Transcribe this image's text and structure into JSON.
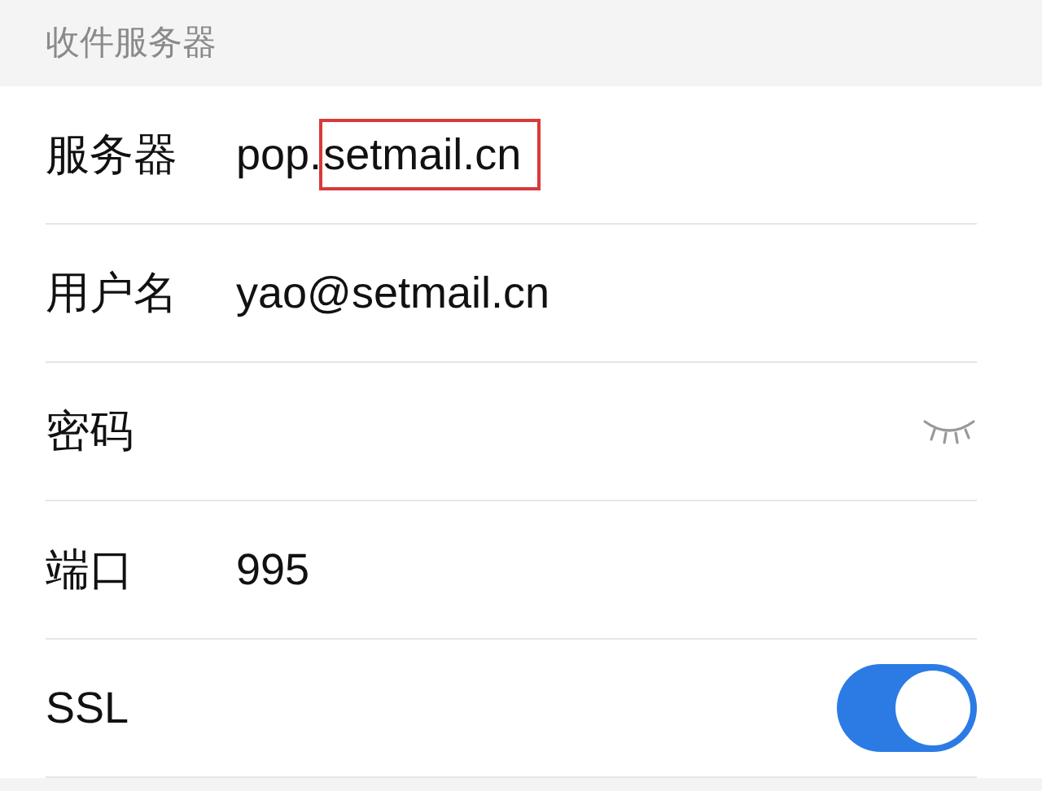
{
  "section_header": "收件服务器",
  "rows": [
    {
      "kind": "text",
      "label": "服务器",
      "value_parts": [
        {
          "text": "pop.",
          "highlighted": false
        },
        {
          "text": "setmail.cn",
          "highlighted": true
        }
      ]
    },
    {
      "kind": "text",
      "label": "用户名",
      "value_parts": [
        {
          "text": "yao@setmail.cn",
          "highlighted": false
        }
      ]
    },
    {
      "kind": "password",
      "label": "密码",
      "revealed": false
    },
    {
      "kind": "text",
      "label": "端口",
      "value_parts": [
        {
          "text": "995",
          "highlighted": false
        }
      ]
    },
    {
      "kind": "toggle",
      "label": "SSL",
      "on": true
    }
  ]
}
